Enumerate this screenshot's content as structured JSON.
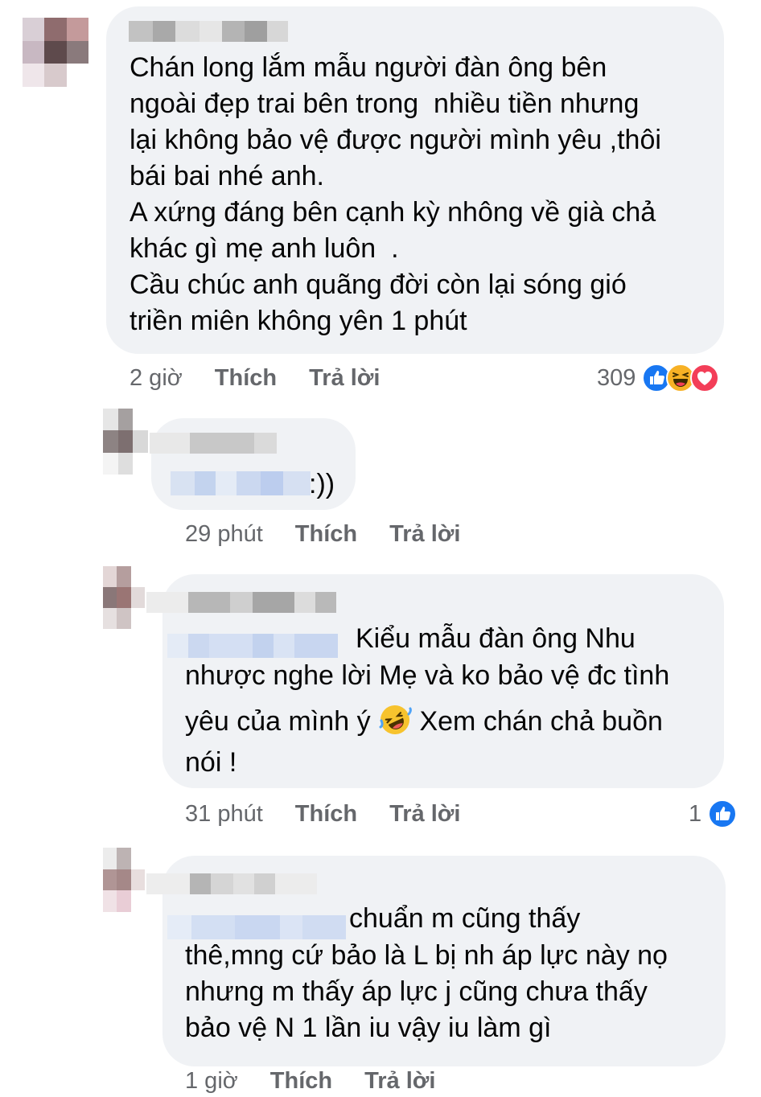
{
  "colors": {
    "bubble": "#f0f2f5",
    "meta_text": "#65676b",
    "like_blue": "#1877f2",
    "love_red": "#f33e58",
    "haha_yellow": "#f7b125"
  },
  "comments": [
    {
      "text": "Chán long lắm mẫu người đàn ông bên\nngoài đẹp trai bên trong  nhiều tiền nhưng\nlại không bảo vệ được người mình yêu ,thôi\nbái bai nhé anh.\nA xứng đáng bên cạnh kỳ nhông về già chả\nkhác gì mẹ anh luôn  .\nCầu chúc anh quãng đời còn lại sóng gió\ntriền miên không yên 1 phút",
      "time": "2 giờ",
      "like_label": "Thích",
      "reply_label": "Trả lời",
      "reaction_count": "309",
      "reaction_icons": [
        "like-icon",
        "haha-icon",
        "love-icon"
      ]
    },
    {
      "text_suffix": ":))",
      "time": "29 phút",
      "like_label": "Thích",
      "reply_label": "Trả lời"
    },
    {
      "first_line": "Kiểu mẫu đàn ông Nhu",
      "line2": "nhược nghe lời Mẹ và ko bảo vệ đc tình",
      "line3_before": "yêu của mình ý ",
      "line3_after": " Xem chán chả buồn",
      "line4": "nói !",
      "emoji": "rolling-on-floor-laughing-icon",
      "time": "31 phút",
      "like_label": "Thích",
      "reply_label": "Trả lời",
      "reaction_count": "1",
      "reaction_icons": [
        "like-icon"
      ]
    },
    {
      "first_line": "chuẩn m cũng thấy",
      "rest": "thê,mng cứ bảo là L bị nh áp lực này nọ\nnhưng m thấy áp lực j cũng chưa thấy\nbảo vệ N 1 lần iu vậy iu làm gì",
      "time": "1 giờ",
      "like_label": "Thích",
      "reply_label": "Trả lời"
    }
  ]
}
